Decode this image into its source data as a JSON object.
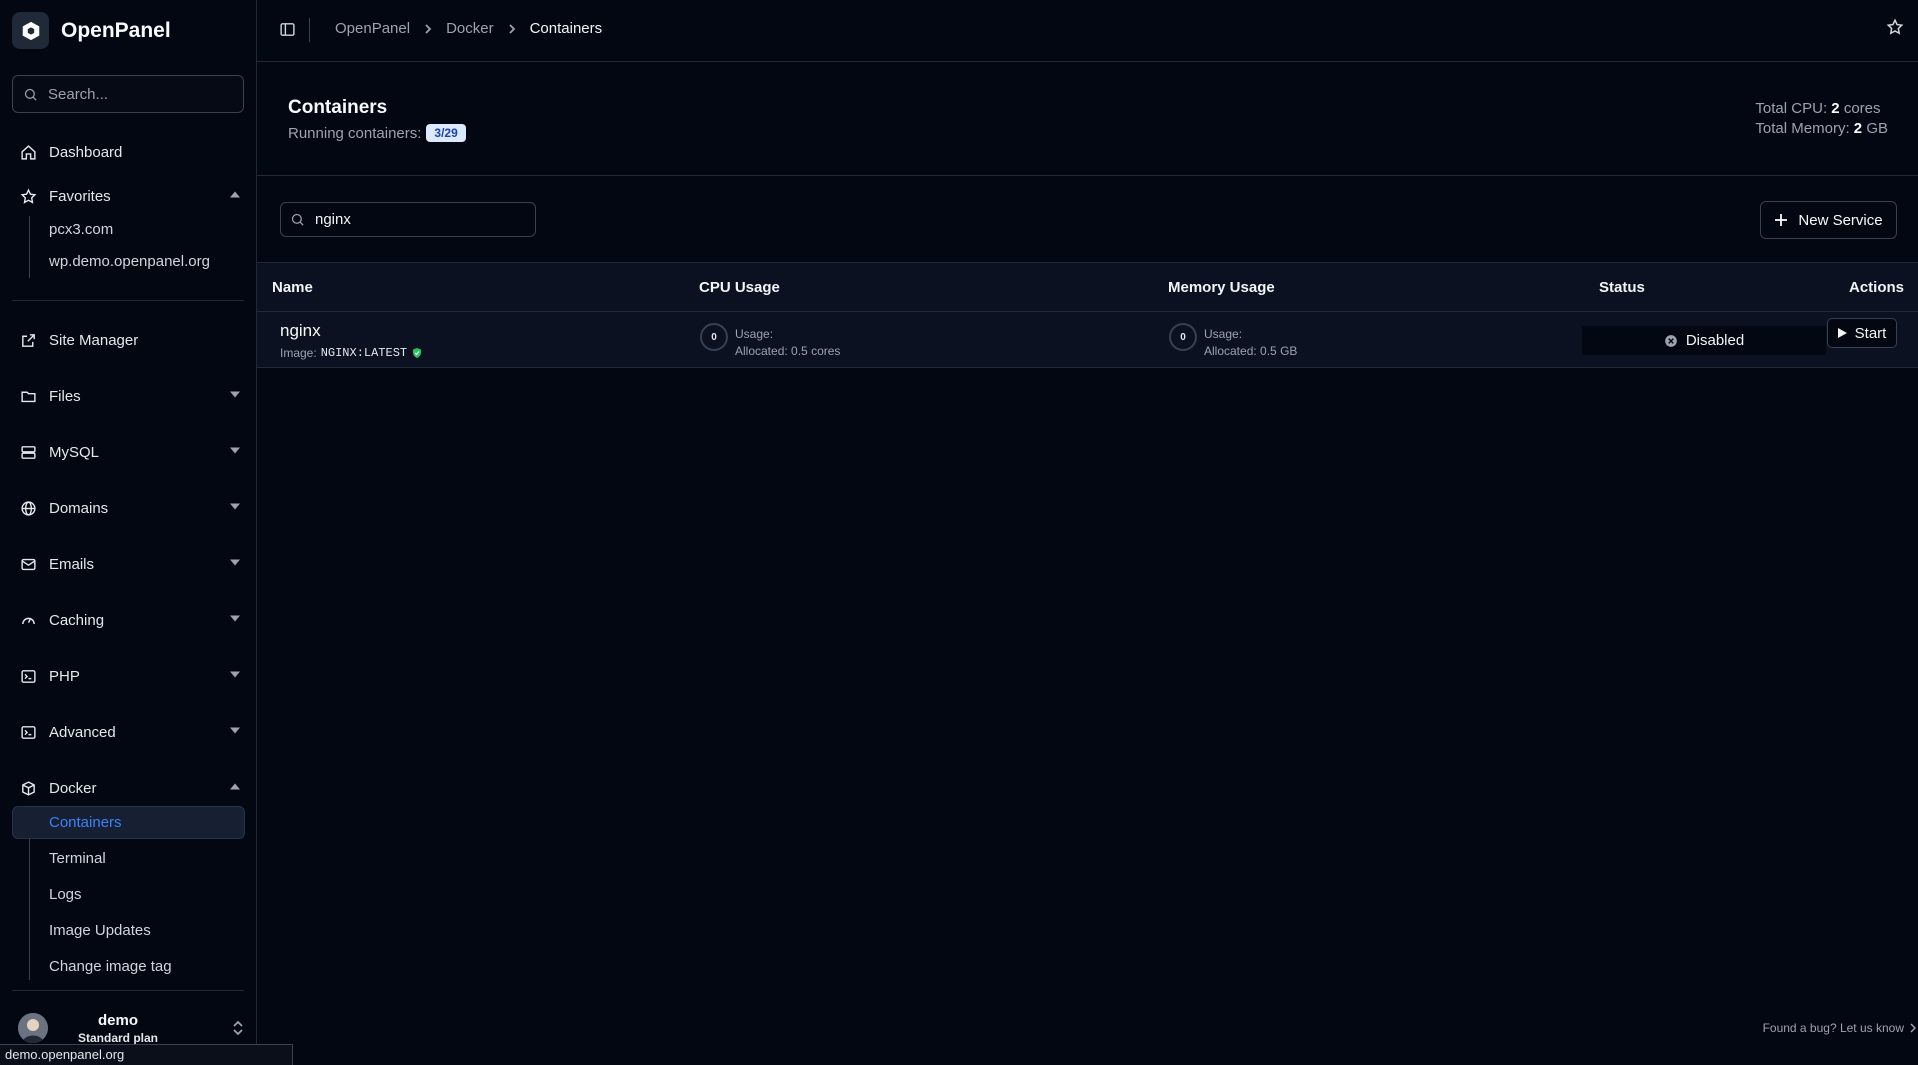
{
  "app": {
    "name": "OpenPanel"
  },
  "sidebar": {
    "search_placeholder": "Search...",
    "dashboard": "Dashboard",
    "favorites": {
      "label": "Favorites",
      "items": [
        "pcx3.com",
        "wp.demo.openpanel.org"
      ]
    },
    "site_manager": "Site Manager",
    "sections": [
      "Files",
      "MySQL",
      "Domains",
      "Emails",
      "Caching",
      "PHP",
      "Advanced"
    ],
    "docker": {
      "label": "Docker",
      "items": [
        "Containers",
        "Terminal",
        "Logs",
        "Image Updates",
        "Change image tag"
      ],
      "active": "Containers"
    },
    "user": {
      "name": "demo",
      "plan": "Standard plan"
    }
  },
  "status_bar": {
    "url": "demo.openpanel.org"
  },
  "header": {
    "breadcrumb": [
      "OpenPanel",
      "Docker",
      "Containers"
    ]
  },
  "page": {
    "title": "Containers",
    "running_label": "Running containers:",
    "running_badge": "3/29",
    "total_cpu_label": "Total CPU:",
    "total_cpu_value": "2",
    "total_cpu_unit": "cores",
    "total_memory_label": "Total Memory:",
    "total_memory_value": "2",
    "total_memory_unit": "GB"
  },
  "toolbar": {
    "search_value": "nginx",
    "new_service_label": "New Service"
  },
  "table": {
    "columns": [
      "Name",
      "CPU Usage",
      "Memory Usage",
      "Status",
      "Actions"
    ],
    "rows": [
      {
        "name": "nginx",
        "image_label": "Image:",
        "image": "NGINX:LATEST",
        "cpu_gauge": "0",
        "cpu_usage_label": "Usage:",
        "cpu_allocated_label": "Allocated:",
        "cpu_allocated": "0.5 cores",
        "mem_gauge": "0",
        "mem_usage_label": "Usage:",
        "mem_allocated_label": "Allocated:",
        "mem_allocated": "0.5 GB",
        "status": "Disabled",
        "action": "Start"
      }
    ]
  },
  "footer": {
    "bug_link": "Found a bug? Let us know"
  },
  "colors": {
    "accent": "#3b82f6",
    "verified": "#22c55e",
    "background": "#030712"
  }
}
